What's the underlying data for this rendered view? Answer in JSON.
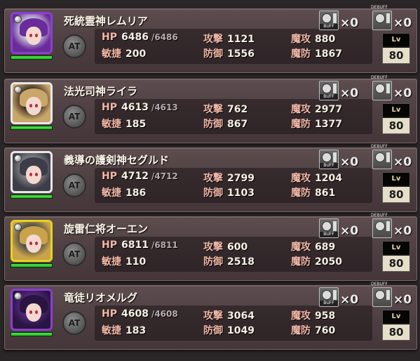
{
  "cards": [
    {
      "name": "死統霊神レムリア",
      "frame_color": "#8a3fd1",
      "portrait_colors": [
        "#d8dde8",
        "#6a2c9a"
      ],
      "at_label": "AT",
      "hp_label": "HP",
      "hp": "6486",
      "hp_max": "/6486",
      "spd_label": "敏捷",
      "spd": "200",
      "atk_label": "攻撃",
      "atk": "1121",
      "def_label": "防御",
      "def": "1556",
      "matk_label": "魔攻",
      "matk": "880",
      "mdef_label": "魔防",
      "mdef": "1867",
      "buff_tag": "BUFF",
      "buff_count": "×0",
      "debuff_tag": "DEBUFF",
      "debuff_count": "×0",
      "lv_label": "Lv",
      "lv": "80",
      "hp_fill": 1.0
    },
    {
      "name": "法光司神ライラ",
      "frame_color": "#e8e8e8",
      "portrait_colors": [
        "#2a1a14",
        "#c9a76b"
      ],
      "at_label": "AT",
      "hp_label": "HP",
      "hp": "4613",
      "hp_max": "/4613",
      "spd_label": "敏捷",
      "spd": "185",
      "atk_label": "攻撃",
      "atk": "762",
      "def_label": "防御",
      "def": "867",
      "matk_label": "魔攻",
      "matk": "2977",
      "mdef_label": "魔防",
      "mdef": "1377",
      "buff_tag": "BUFF",
      "buff_count": "×0",
      "debuff_tag": "DEBUFF",
      "debuff_count": "×0",
      "lv_label": "Lv",
      "lv": "80",
      "hp_fill": 1.0
    },
    {
      "name": "義導の護剣神セグルド",
      "frame_color": "#e8e8e8",
      "portrait_colors": [
        "#8c8c8c",
        "#3d3d4a"
      ],
      "at_label": "AT",
      "hp_label": "HP",
      "hp": "4712",
      "hp_max": "/4712",
      "spd_label": "敏捷",
      "spd": "186",
      "atk_label": "攻撃",
      "atk": "2799",
      "def_label": "防御",
      "def": "1103",
      "matk_label": "魔攻",
      "matk": "1204",
      "mdef_label": "魔防",
      "mdef": "861",
      "buff_tag": "BUFF",
      "buff_count": "×0",
      "debuff_tag": "DEBUFF",
      "debuff_count": "×0",
      "lv_label": "Lv",
      "lv": "80",
      "hp_fill": 1.0
    },
    {
      "name": "旋雷仁将オーエン",
      "frame_color": "#e6d21f",
      "portrait_colors": [
        "#2f3a4a",
        "#c9a24a"
      ],
      "at_label": "AT",
      "hp_label": "HP",
      "hp": "6811",
      "hp_max": "/6811",
      "spd_label": "敏捷",
      "spd": "110",
      "atk_label": "攻撃",
      "atk": "600",
      "def_label": "防御",
      "def": "2518",
      "matk_label": "魔攻",
      "matk": "689",
      "mdef_label": "魔防",
      "mdef": "2050",
      "buff_tag": "BUFF",
      "buff_count": "×0",
      "debuff_tag": "DEBUFF",
      "debuff_count": "×0",
      "lv_label": "Lv",
      "lv": "80",
      "hp_fill": 1.0
    },
    {
      "name": "竜徒リオメルグ",
      "frame_color": "#8a3fd1",
      "portrait_colors": [
        "#5b2a8c",
        "#2a1540"
      ],
      "at_label": "AT",
      "hp_label": "HP",
      "hp": "4608",
      "hp_max": "/4608",
      "spd_label": "敏捷",
      "spd": "183",
      "atk_label": "攻撃",
      "atk": "3064",
      "def_label": "防御",
      "def": "1049",
      "matk_label": "魔攻",
      "matk": "958",
      "mdef_label": "魔防",
      "mdef": "760",
      "buff_tag": "BUFF",
      "buff_count": "×0",
      "debuff_tag": "DEBUFF",
      "debuff_count": "×0",
      "lv_label": "Lv",
      "lv": "80",
      "hp_fill": 1.0
    }
  ]
}
